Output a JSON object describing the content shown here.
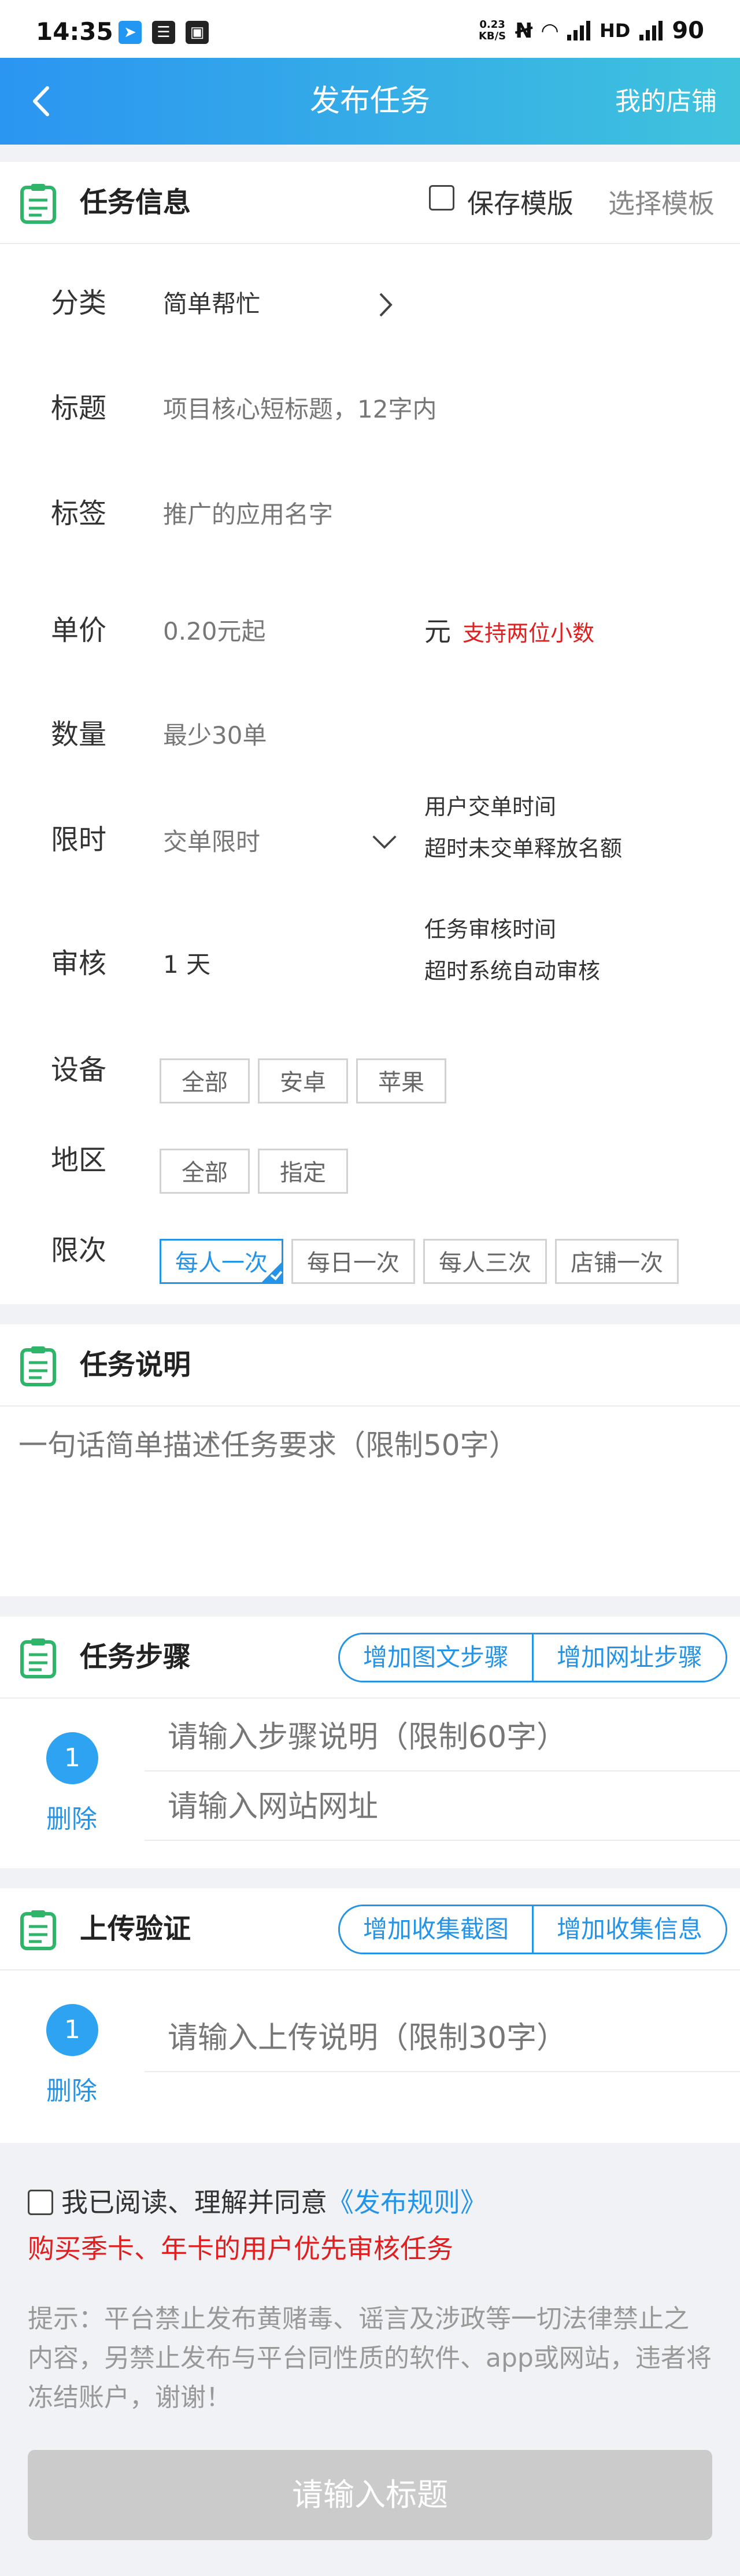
{
  "status_bar": {
    "time": "14:35",
    "net_speed_top": "0.23",
    "net_speed_bottom": "KB/S",
    "signal_label": "HD",
    "battery": "90"
  },
  "header": {
    "title": "发布任务",
    "shop_link": "我的店铺"
  },
  "task_info": {
    "title": "任务信息",
    "save_template": "保存模版",
    "choose_template": "选择模板",
    "category": {
      "label": "分类",
      "value": "简单帮忙"
    },
    "headline": {
      "label": "标题",
      "placeholder": "项目核心短标题，12字内"
    },
    "tags": {
      "label": "标签",
      "placeholder": "推广的应用名字"
    },
    "price": {
      "label": "单价",
      "placeholder": "0.20元起",
      "unit": "元",
      "note": "支持两位小数"
    },
    "quantity": {
      "label": "数量",
      "placeholder": "最少30单"
    },
    "time_limit": {
      "label": "限时",
      "placeholder": "交单限时",
      "hint1": "用户交单时间",
      "hint2": "超时未交单释放名额"
    },
    "review": {
      "label": "审核",
      "value": "1 天",
      "hint1": "任务审核时间",
      "hint2": "超时系统自动审核"
    },
    "device": {
      "label": "设备",
      "options": [
        "全部",
        "安卓",
        "苹果"
      ]
    },
    "region": {
      "label": "地区",
      "options": [
        "全部",
        "指定"
      ]
    },
    "frequency": {
      "label": "限次",
      "options": [
        "每人一次",
        "每日一次",
        "每人三次",
        "店铺一次"
      ],
      "selected": "每人一次"
    }
  },
  "task_desc": {
    "title": "任务说明",
    "placeholder": "一句话简单描述任务要求（限制50字）"
  },
  "task_steps": {
    "title": "任务步骤",
    "add_image_step": "增加图文步骤",
    "add_url_step": "增加网址步骤",
    "step_number": "1",
    "delete": "删除",
    "step_placeholder": "请输入步骤说明（限制60字）",
    "url_placeholder": "请输入网站网址"
  },
  "upload_verify": {
    "title": "上传验证",
    "add_screenshot": "增加收集截图",
    "add_info": "增加收集信息",
    "item_number": "1",
    "delete": "删除",
    "placeholder": "请输入上传说明（限制30字）"
  },
  "footer": {
    "agree_text": "我已阅读、理解并同意",
    "rules_link": "《发布规则》",
    "priority_notice": "购买季卡、年卡的用户优先审核任务",
    "tip": "提示：平台禁止发布黄赌毒、谣言及涉政等一切法律禁止之内容，另禁止发布与平台同性质的软件、app或网站，违者将冻结账户，谢谢！",
    "submit": "请输入标题"
  },
  "colors": {
    "accent": "#2593e6",
    "warning": "#e02020",
    "header_start": "#2b95f1",
    "header_end": "#3fc3dd",
    "icon_green": "#2fb56a"
  }
}
